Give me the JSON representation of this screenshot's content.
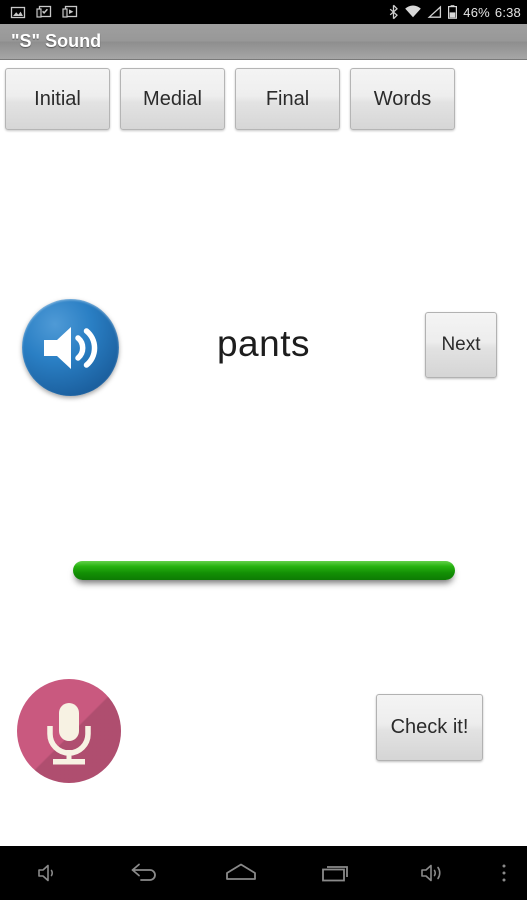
{
  "statusbar": {
    "left_icons": [
      {
        "name": "gallery-image-icon"
      },
      {
        "name": "screenshot-capture-icon"
      },
      {
        "name": "screen-record-icon"
      }
    ],
    "right_icons": [
      {
        "name": "bluetooth-icon"
      },
      {
        "name": "wifi-icon"
      },
      {
        "name": "cell-signal-icon"
      },
      {
        "name": "battery-icon"
      }
    ],
    "battery_percent": "46%",
    "clock": "6:38"
  },
  "titlebar": {
    "title": "\"S\" Sound"
  },
  "tabs": [
    {
      "label": "Initial",
      "name": "tab-initial"
    },
    {
      "label": "Medial",
      "name": "tab-medial"
    },
    {
      "label": "Final",
      "name": "tab-final"
    },
    {
      "label": "Words",
      "name": "tab-words"
    }
  ],
  "practice": {
    "word": "pants",
    "next_label": "Next",
    "check_label": "Check it!",
    "speaker_icon": "speaker-volume-icon",
    "mic_icon": "microphone-icon",
    "level_bar_name": "audio-level-bar"
  },
  "colors": {
    "speaker_blue": "#1b5f9e",
    "mic_pink": "#c9597f",
    "level_green": "#13a00a",
    "titlebar_gray": "#989898"
  },
  "navbar": [
    {
      "name": "nav-volume-down",
      "icon": "volume-down-icon"
    },
    {
      "name": "nav-back",
      "icon": "back-arrow-icon"
    },
    {
      "name": "nav-home",
      "icon": "home-icon"
    },
    {
      "name": "nav-recents",
      "icon": "recents-icon"
    },
    {
      "name": "nav-volume-up",
      "icon": "volume-up-icon"
    },
    {
      "name": "nav-overflow-menu",
      "icon": "kebab-menu-icon"
    }
  ]
}
